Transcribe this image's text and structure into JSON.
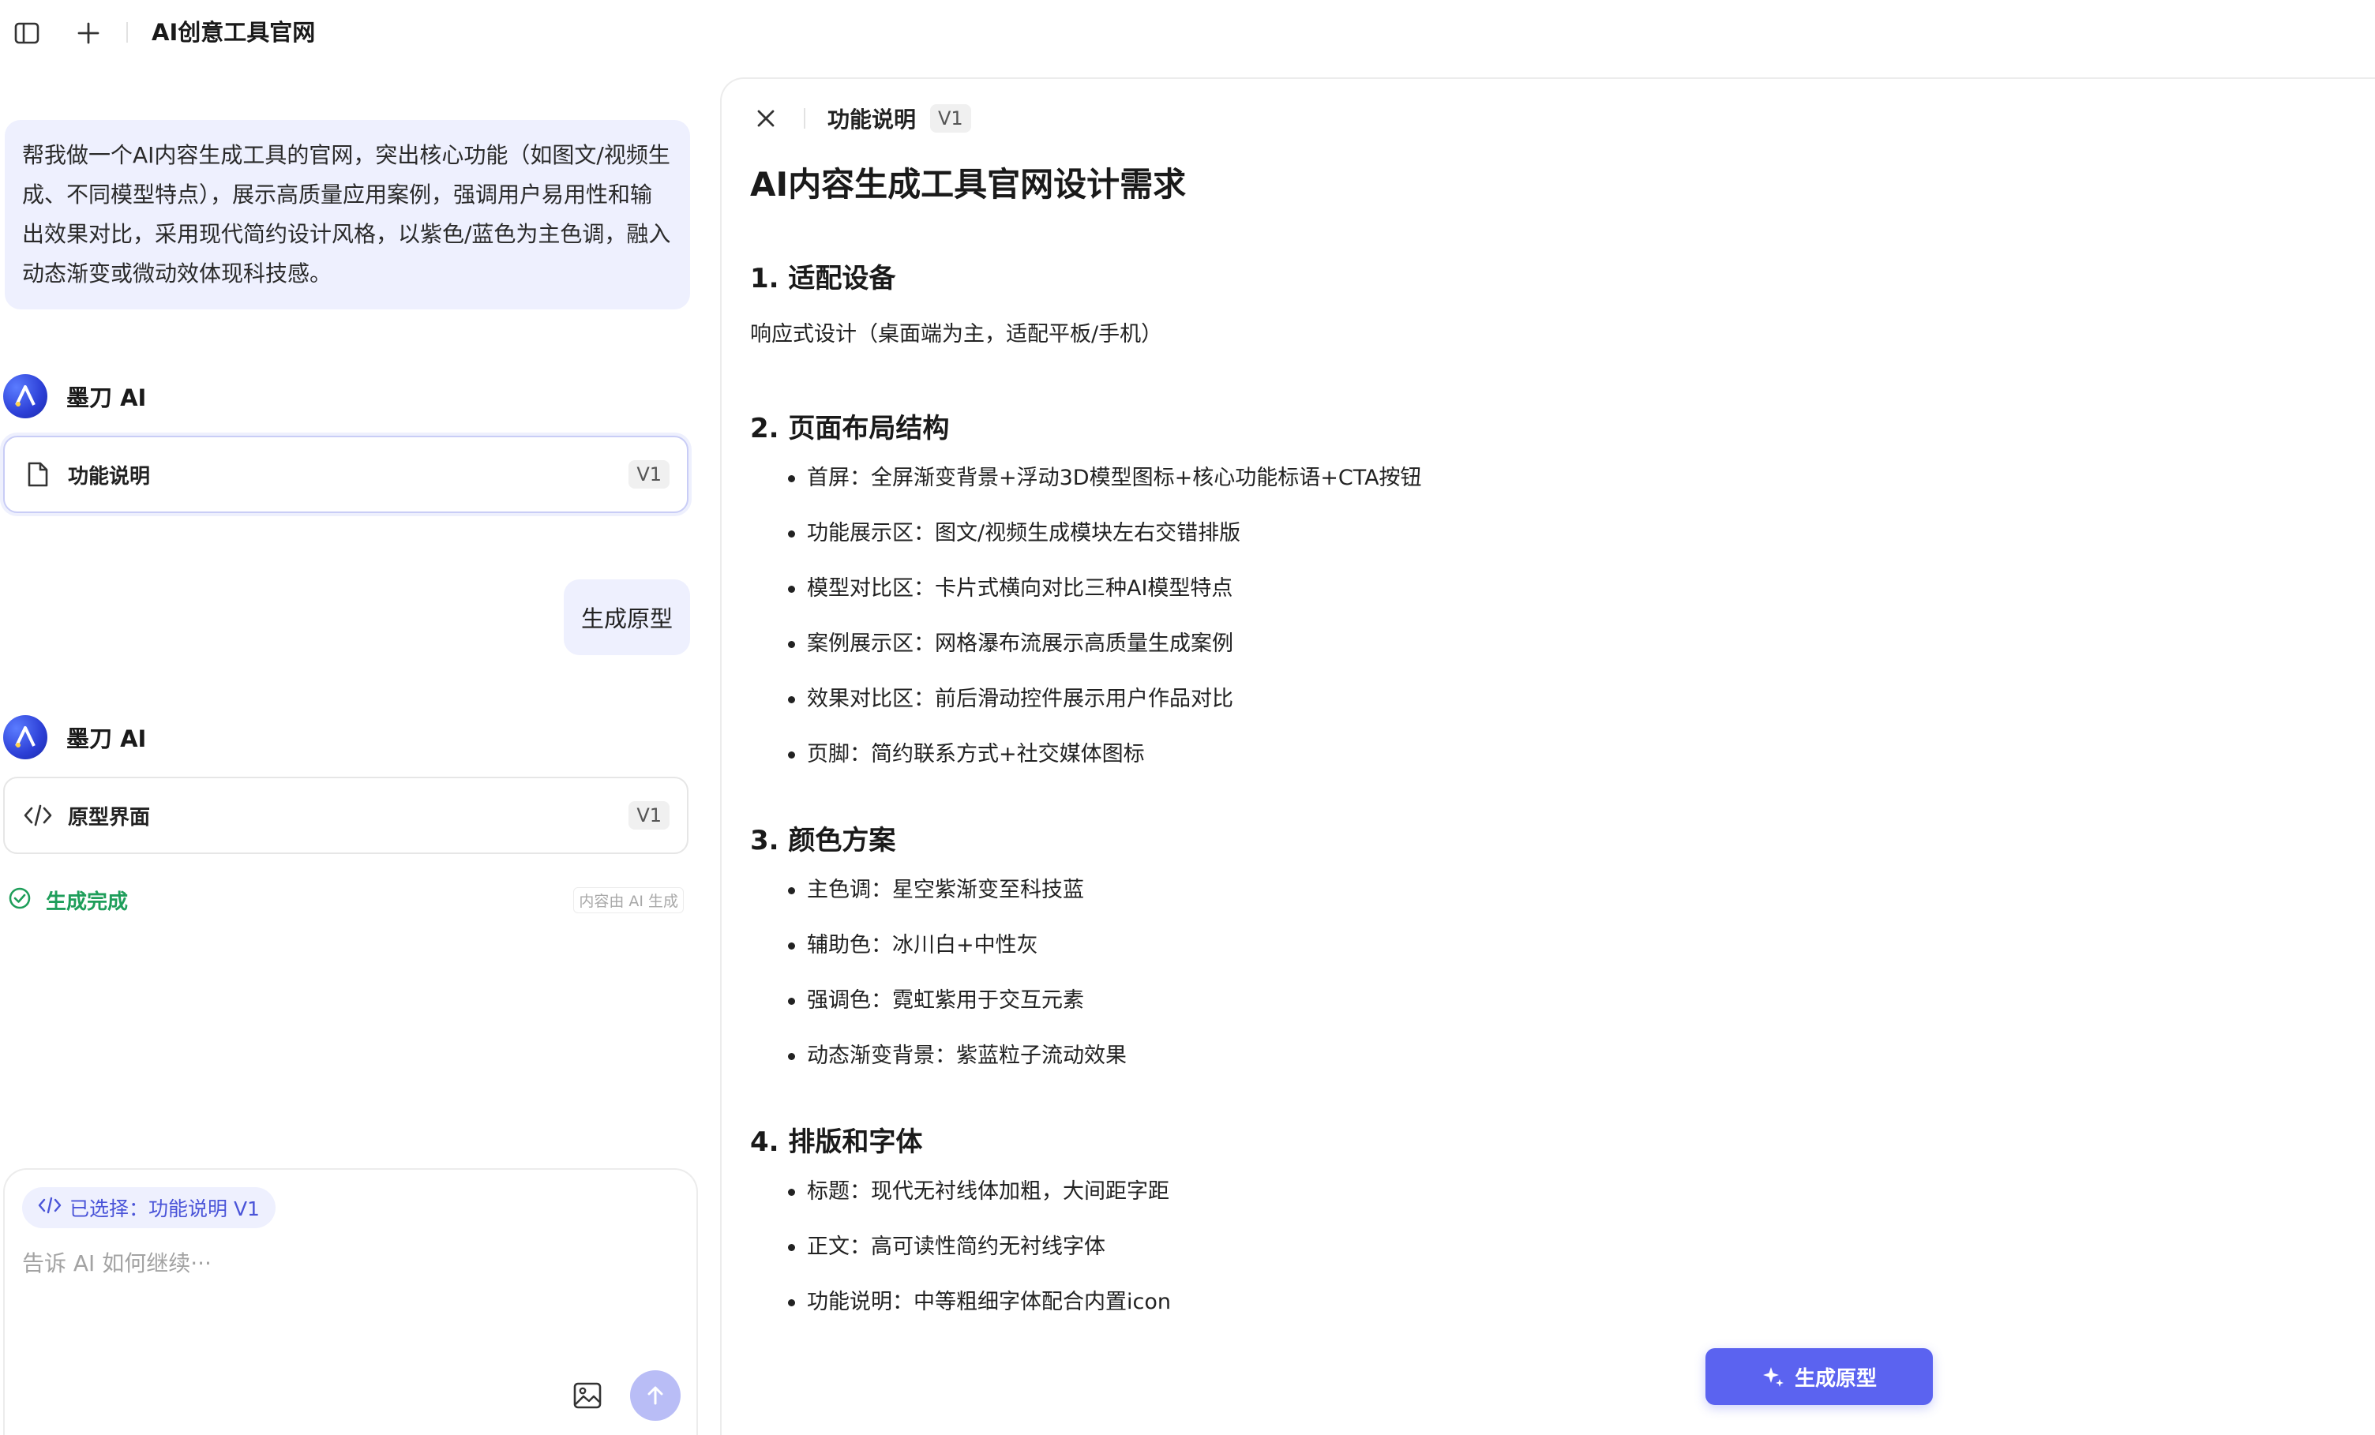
{
  "topbar": {
    "title": "AI创意工具官网",
    "icons": [
      "sidebar-toggle-icon",
      "plus-icon"
    ]
  },
  "chat": {
    "user_prompt": "帮我做一个AI内容生成工具的官网，突出核心功能（如图文/视频生成、不同模型特点），展示高质量应用案例，强调用户易用性和输出效果对比，采用现代简约设计风格，以紫色/蓝色为主色调，融入动态渐变或微动效体现科技感。",
    "ai_name": "墨刀 AI",
    "card1": {
      "label": "功能说明",
      "version": "V1",
      "icon": "document-icon"
    },
    "user_reply": "生成原型",
    "card2": {
      "label": "原型界面",
      "version": "V1",
      "icon": "code-icon"
    },
    "status": "生成完成",
    "disclaimer": "内容由 AI 生成"
  },
  "composer": {
    "chip": "已选择：功能说明 V1",
    "placeholder": "告诉 AI 如何继续···",
    "value": ""
  },
  "doc": {
    "tab": "功能说明",
    "version": "V1",
    "title": "AI内容生成工具官网设计需求",
    "sections": [
      {
        "heading": "1. 适配设备",
        "paragraph": "响应式设计（桌面端为主，适配平板/手机）"
      },
      {
        "heading": "2. 页面布局结构",
        "items": [
          "首屏：全屏渐变背景+浮动3D模型图标+核心功能标语+CTA按钮",
          "功能展示区：图文/视频生成模块左右交错排版",
          "模型对比区：卡片式横向对比三种AI模型特点",
          "案例展示区：网格瀑布流展示高质量生成案例",
          "效果对比区：前后滑动控件展示用户作品对比",
          "页脚：简约联系方式+社交媒体图标"
        ]
      },
      {
        "heading": "3. 颜色方案",
        "items": [
          "主色调：星空紫渐变至科技蓝",
          "辅助色：冰川白+中性灰",
          "强调色：霓虹紫用于交互元素",
          "动态渐变背景：紫蓝粒子流动效果"
        ]
      },
      {
        "heading": "4. 排版和字体",
        "items": [
          "标题：现代无衬线体加粗，大间距字距",
          "正文：高可读性简约无衬线字体",
          "功能说明：中等粗细字体配合内置icon"
        ]
      }
    ],
    "generate_button": "生成原型"
  },
  "colors": {
    "accent": "#5b63f0",
    "bubble": "#eef0fe",
    "success": "#1e9e5a",
    "send_disabled": "#b9bdf6"
  }
}
